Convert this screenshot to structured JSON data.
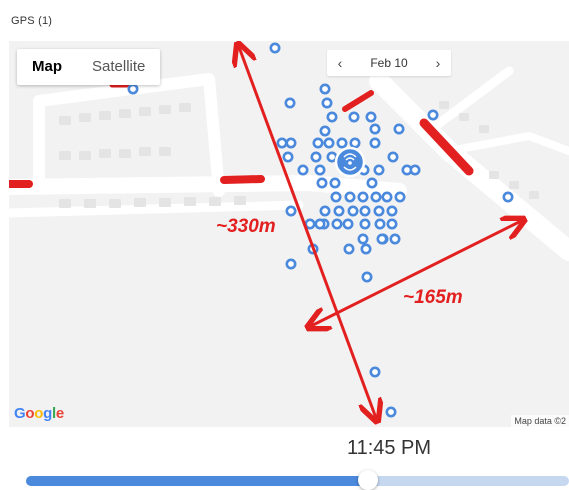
{
  "header": {
    "title": "GPS (1)"
  },
  "map": {
    "type_buttons": [
      {
        "label": "Map",
        "active": true
      },
      {
        "label": "Satellite",
        "active": false
      }
    ],
    "date_nav": {
      "prev_glyph": "‹",
      "date": "Feb 10",
      "next_glyph": "›"
    },
    "logo_letters": [
      "G",
      "o",
      "o",
      "g",
      "l",
      "e"
    ],
    "attribution": "Map data ©2",
    "annotations": {
      "distance_long": "~330m",
      "distance_short": "~165m"
    },
    "colors": {
      "marker": "#4a89dc",
      "annotation": "#e32020"
    },
    "icons": {
      "location_marker": "location-dot-icon",
      "center": "wifi-signal-icon"
    }
  },
  "timeline": {
    "time": "11:45 PM",
    "progress": 0.63
  }
}
